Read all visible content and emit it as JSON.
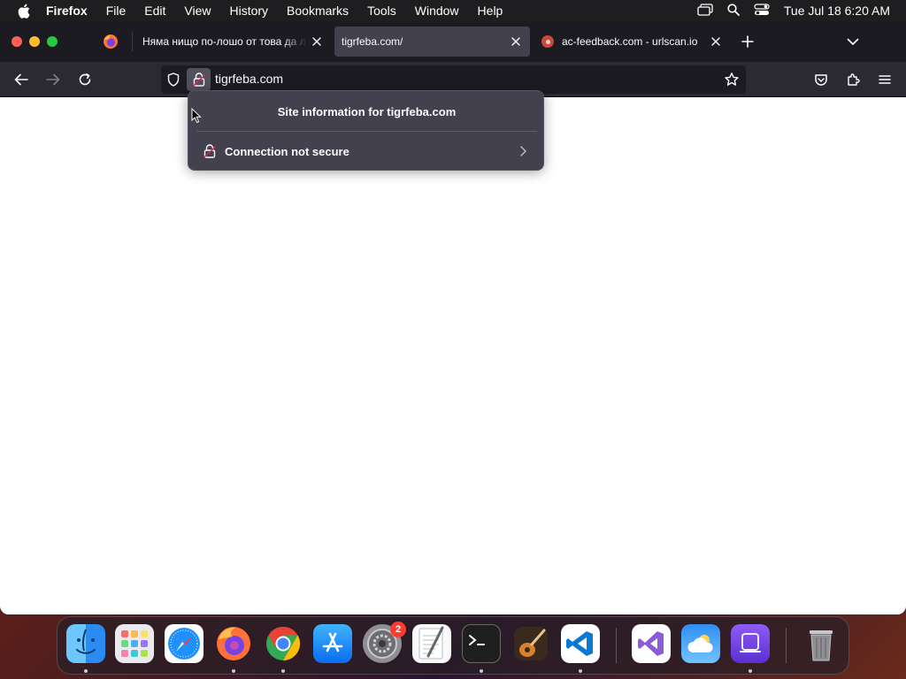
{
  "menubar": {
    "app_name": "Firefox",
    "menus": [
      "File",
      "Edit",
      "View",
      "History",
      "Bookmarks",
      "Tools",
      "Window",
      "Help"
    ],
    "clock": "Tue Jul 18  6:20 AM"
  },
  "tabs": [
    {
      "title": "Няма нищо по-лошо от това да ле",
      "active": false
    },
    {
      "title": "tigrfeba.com/",
      "active": true
    },
    {
      "title": "ac-feedback.com - urlscan.io",
      "active": false
    }
  ],
  "urlbar": {
    "url": "tigrfeba.com"
  },
  "site_info_popup": {
    "title": "Site information for tigrfeba.com",
    "connection_label": "Connection not secure"
  },
  "dock": {
    "apps": [
      "Finder",
      "Launchpad",
      "Safari",
      "Firefox",
      "Chrome",
      "App Store",
      "System Settings",
      "TextEdit",
      "Terminal",
      "GarageBand",
      "Visual Studio Code",
      "Visual Studio",
      "Weather",
      "Apple Configurator",
      "Trash"
    ],
    "system_settings_badge": "2"
  },
  "colors": {
    "tab_bar": "#1c1b22",
    "toolbar": "#2b2a33",
    "active_tab": "#42414d",
    "popup": "#42414d"
  }
}
